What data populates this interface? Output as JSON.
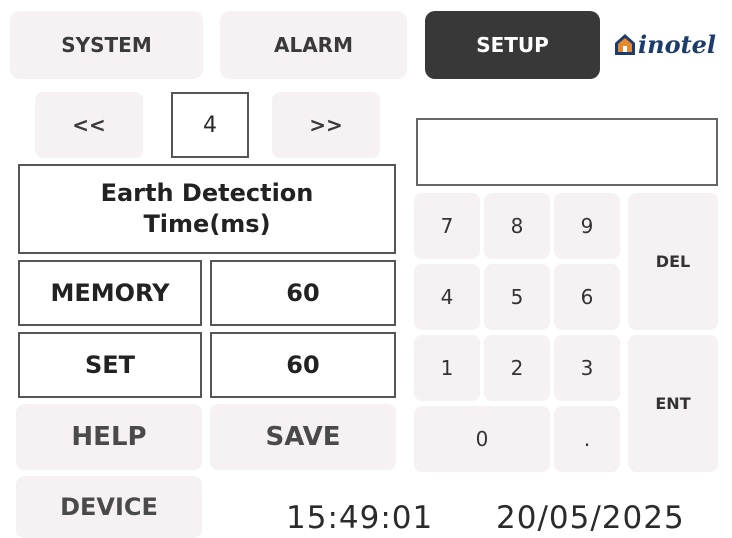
{
  "tabs": {
    "system": "SYSTEM",
    "alarm": "ALARM",
    "setup": "SETUP"
  },
  "brand": {
    "name": "inotel"
  },
  "nav": {
    "prev": "<<",
    "page": "4",
    "next": ">>"
  },
  "parameter": {
    "title": "Earth Detection Time(ms)"
  },
  "memory": {
    "label": "MEMORY",
    "value": "60"
  },
  "set": {
    "label": "SET",
    "value": "60"
  },
  "actions": {
    "help": "HELP",
    "save": "SAVE",
    "device": "DEVICE"
  },
  "keypad": {
    "display": "",
    "k7": "7",
    "k8": "8",
    "k9": "9",
    "k4": "4",
    "k5": "5",
    "k6": "6",
    "k1": "1",
    "k2": "2",
    "k3": "3",
    "k0": "0",
    "dot": ".",
    "del": "DEL",
    "ent": "ENT"
  },
  "status": {
    "time": "15:49:01",
    "date": "20/05/2025"
  }
}
